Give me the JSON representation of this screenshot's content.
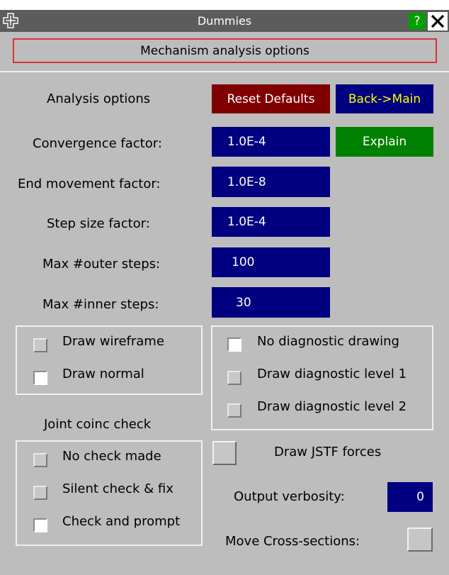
{
  "window": {
    "title": "Dummies",
    "help_label": "?",
    "close_label": "✕"
  },
  "header": {
    "heading": "Mechanism analysis options",
    "accent": "#e03030"
  },
  "analysis": {
    "label": "Analysis options",
    "reset_label": "Reset Defaults",
    "back_label": "Back->Main",
    "explain_label": "Explain"
  },
  "params": [
    {
      "label": "Convergence factor:",
      "value": "1.0E-4"
    },
    {
      "label": "End movement factor:",
      "value": "1.0E-8"
    },
    {
      "label": "Step size factor:",
      "value": "1.0E-4"
    },
    {
      "label": "Max #outer steps:",
      "value": "100"
    },
    {
      "label": "Max #inner steps:",
      "value": "30"
    }
  ],
  "draw_mode": [
    {
      "label": "Draw wireframe",
      "checked": false
    },
    {
      "label": "Draw normal",
      "checked": true
    }
  ],
  "diagnostic": [
    {
      "label": "No diagnostic drawing",
      "checked": true
    },
    {
      "label": "Draw diagnostic level 1",
      "checked": false
    },
    {
      "label": "Draw diagnostic level 2",
      "checked": false
    }
  ],
  "joint": {
    "label": "Joint coinc check",
    "options": [
      {
        "label": "No check made",
        "checked": false
      },
      {
        "label": "Silent check & fix",
        "checked": false
      },
      {
        "label": "Check and prompt",
        "checked": true
      }
    ]
  },
  "jstf": {
    "label": "Draw JSTF forces"
  },
  "verbosity": {
    "label": "Output verbosity:",
    "value": "0"
  },
  "cross_sections": {
    "label": "Move Cross-sections:"
  },
  "colors": {
    "field_bg": "#000080",
    "reset_bg": "#800000",
    "back_bg": "#000080",
    "back_text": "#ffff00",
    "explain_bg": "#008000",
    "panel_bg": "#bdbdbd",
    "title_bg": "#5c5c5c"
  },
  "icons": {
    "move": "move-cross-icon",
    "help": "help-icon",
    "close": "close-icon"
  }
}
